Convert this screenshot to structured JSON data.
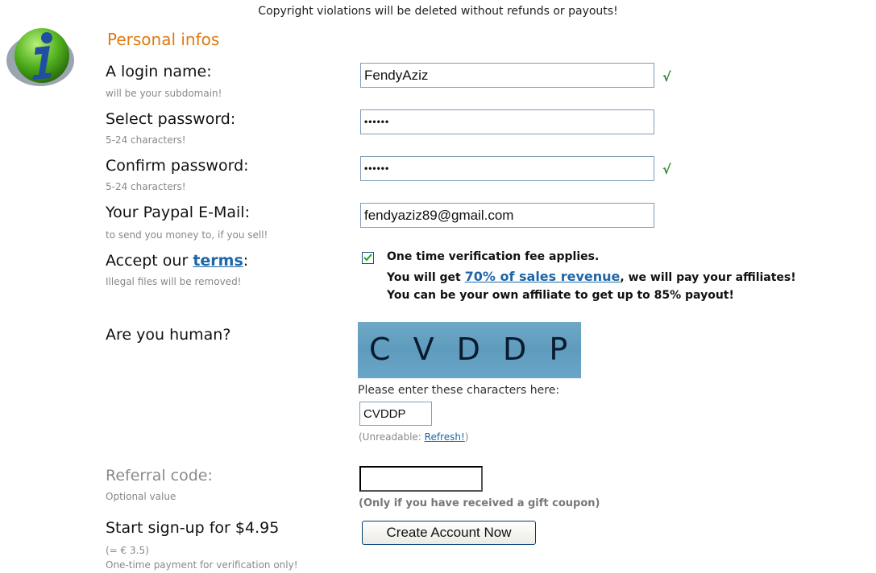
{
  "notice": "Copyright violations will be deleted without refunds or payouts!",
  "section_title": "Personal infos",
  "login": {
    "label": "A login name:",
    "hint": "will be your subdomain!",
    "value": "FendyAziz",
    "valid_mark": "√"
  },
  "password": {
    "label": "Select password:",
    "hint": "5-24 characters!",
    "value": "••••••"
  },
  "confirm": {
    "label": "Confirm password:",
    "hint": "5-24 characters!",
    "value": "••••••",
    "valid_mark": "√"
  },
  "paypal": {
    "label": "Your Paypal E-Mail:",
    "hint": "to send you money to, if you sell!",
    "value": "fendyaziz89@gmail.com"
  },
  "terms": {
    "label_prefix": "Accept our ",
    "link": "terms",
    "label_suffix": ":",
    "hint": "Illegal files will be removed!",
    "checked": true,
    "line1": "One time verification fee applies.",
    "line2_prefix": "You will get ",
    "line2_link": "70% of sales revenue",
    "line2_suffix": ", we will pay your affiliates!",
    "line3": "You can be your own affiliate to get up to 85% payout!"
  },
  "human": {
    "label": "Are you human?",
    "captcha_text": "C V D D P",
    "instruction": "Please enter these characters here:",
    "value": "CVDDP",
    "unreadable_prefix": "(Unreadable: ",
    "refresh": "Refresh!",
    "unreadable_suffix": ")"
  },
  "referral": {
    "label": "Referral code:",
    "hint": "Optional value",
    "value": "",
    "note": "(Only if you have received a gift coupon)"
  },
  "signup": {
    "label": "Start sign-up for $4.95",
    "euro": "(= € 3.5)",
    "note": "One-time payment for verification only!",
    "button": "Create Account Now"
  },
  "colors": {
    "accent": "#e07a10",
    "link": "#1d66a8",
    "valid": "#2f8a2f"
  }
}
